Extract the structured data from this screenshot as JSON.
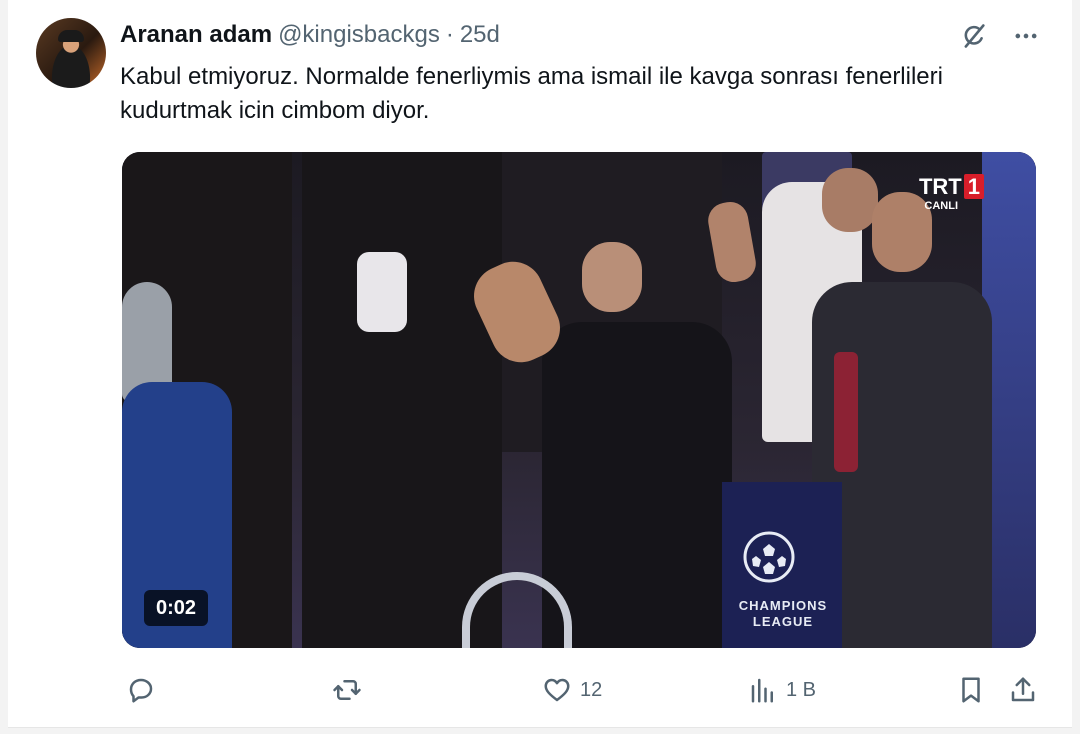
{
  "tweet": {
    "author_name": "Aranan adam",
    "handle": "@kingisbackgs",
    "separator": "·",
    "time": "25d",
    "text": "Kabul etmiyoruz. Normalde fenerliymis ama ismail ile kavga sonrası fenerlileri kudurtmak icin cimbom diyor."
  },
  "media": {
    "duration": "0:02",
    "channel_logo": "TRT",
    "channel_number": "1",
    "live_label": "CANLI",
    "ucl_label_line1": "CHAMPIONS",
    "ucl_label_line2": "LEAGUE"
  },
  "actions": {
    "reply_count": "",
    "retweet_count": "",
    "like_count": "12",
    "views_count": "1 B"
  },
  "icons": {
    "grok": "grok-icon",
    "more": "more-icon",
    "reply": "reply-icon",
    "retweet": "retweet-icon",
    "like": "heart-icon",
    "views": "views-icon",
    "bookmark": "bookmark-icon",
    "share": "share-icon"
  }
}
